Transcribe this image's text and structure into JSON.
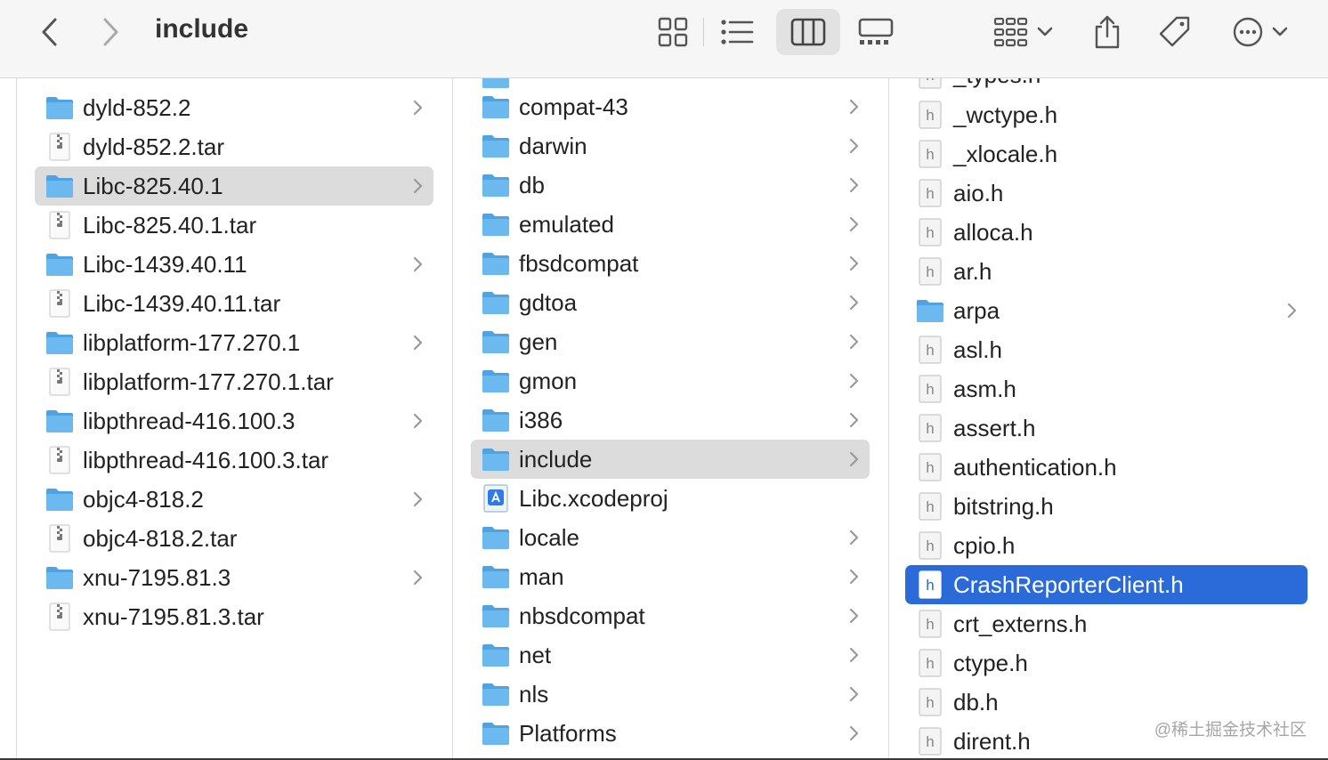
{
  "window": {
    "title": "include"
  },
  "colors": {
    "folder": "#5aaeea",
    "selection_blue": "#2a6bd9",
    "selection_gray": "#dcdcdc"
  },
  "toolbar": {
    "icons": [
      "chevron-left-icon",
      "chevron-right-icon",
      "icon-view-icon",
      "list-view-icon",
      "column-view-icon",
      "gallery-view-icon",
      "group-icon",
      "share-icon",
      "tag-icon",
      "more-icon"
    ],
    "active_view": "columns"
  },
  "column1": {
    "items": [
      {
        "label": "dyld-852.2",
        "kind": "folder"
      },
      {
        "label": "dyld-852.2.tar",
        "kind": "archive"
      },
      {
        "label": "Libc-825.40.1",
        "kind": "folder",
        "selected": "gray"
      },
      {
        "label": "Libc-825.40.1.tar",
        "kind": "archive"
      },
      {
        "label": "Libc-1439.40.11",
        "kind": "folder"
      },
      {
        "label": "Libc-1439.40.11.tar",
        "kind": "archive"
      },
      {
        "label": "libplatform-177.270.1",
        "kind": "folder"
      },
      {
        "label": "libplatform-177.270.1.tar",
        "kind": "archive"
      },
      {
        "label": "libpthread-416.100.3",
        "kind": "folder"
      },
      {
        "label": "libpthread-416.100.3.tar",
        "kind": "archive"
      },
      {
        "label": "objc4-818.2",
        "kind": "folder"
      },
      {
        "label": "objc4-818.2.tar",
        "kind": "archive"
      },
      {
        "label": "xnu-7195.81.3",
        "kind": "folder"
      },
      {
        "label": "xnu-7195.81.3.tar",
        "kind": "archive"
      }
    ]
  },
  "column2": {
    "items": [
      {
        "label": "compat-43",
        "kind": "folder"
      },
      {
        "label": "darwin",
        "kind": "folder"
      },
      {
        "label": "db",
        "kind": "folder"
      },
      {
        "label": "emulated",
        "kind": "folder"
      },
      {
        "label": "fbsdcompat",
        "kind": "folder"
      },
      {
        "label": "gdtoa",
        "kind": "folder"
      },
      {
        "label": "gen",
        "kind": "folder"
      },
      {
        "label": "gmon",
        "kind": "folder"
      },
      {
        "label": "i386",
        "kind": "folder"
      },
      {
        "label": "include",
        "kind": "folder",
        "selected": "gray"
      },
      {
        "label": "Libc.xcodeproj",
        "kind": "xcodeproj"
      },
      {
        "label": "locale",
        "kind": "folder"
      },
      {
        "label": "man",
        "kind": "folder"
      },
      {
        "label": "nbsdcompat",
        "kind": "folder"
      },
      {
        "label": "net",
        "kind": "folder"
      },
      {
        "label": "nls",
        "kind": "folder"
      },
      {
        "label": "Platforms",
        "kind": "folder"
      }
    ]
  },
  "column3": {
    "partial_top": "_types.h",
    "items": [
      {
        "label": "_wctype.h",
        "kind": "header"
      },
      {
        "label": "_xlocale.h",
        "kind": "header"
      },
      {
        "label": "aio.h",
        "kind": "header"
      },
      {
        "label": "alloca.h",
        "kind": "header"
      },
      {
        "label": "ar.h",
        "kind": "header"
      },
      {
        "label": "arpa",
        "kind": "folder"
      },
      {
        "label": "asl.h",
        "kind": "header"
      },
      {
        "label": "asm.h",
        "kind": "header"
      },
      {
        "label": "assert.h",
        "kind": "header"
      },
      {
        "label": "authentication.h",
        "kind": "header"
      },
      {
        "label": "bitstring.h",
        "kind": "header"
      },
      {
        "label": "cpio.h",
        "kind": "header"
      },
      {
        "label": "CrashReporterClient.h",
        "kind": "header",
        "selected": "blue"
      },
      {
        "label": "crt_externs.h",
        "kind": "header"
      },
      {
        "label": "ctype.h",
        "kind": "header"
      },
      {
        "label": "db.h",
        "kind": "header"
      },
      {
        "label": "dirent.h",
        "kind": "header"
      }
    ]
  },
  "watermark": "@稀土掘金技术社区"
}
